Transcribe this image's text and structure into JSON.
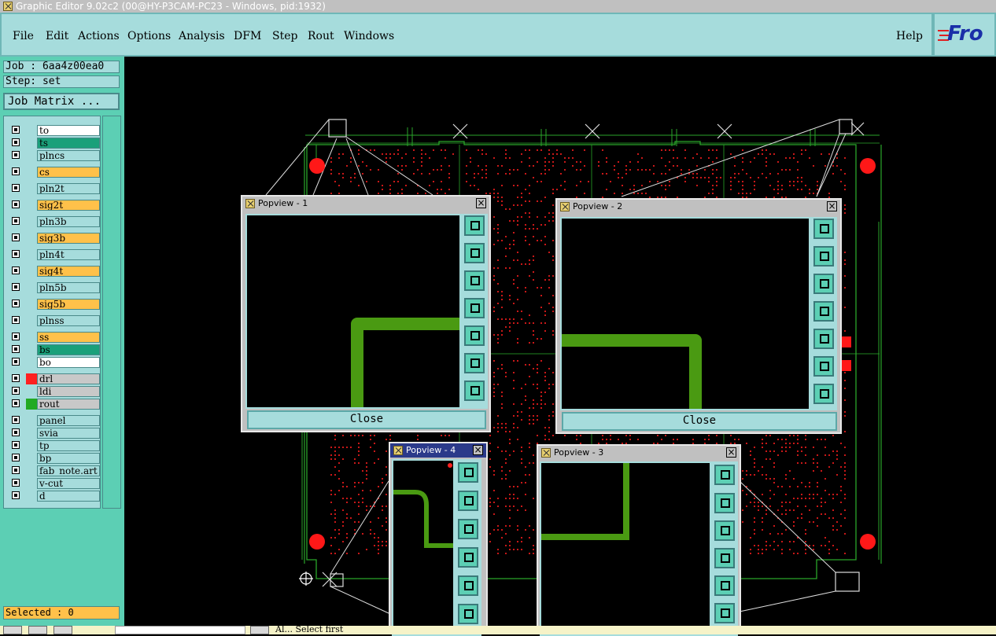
{
  "window": {
    "title": "Graphic Editor 9.02c2 (00@HY-P3CAM-PC23 - Windows, pid:1932)"
  },
  "menu": {
    "items": [
      "File",
      "Edit",
      "Actions",
      "Options",
      "Analysis",
      "DFM",
      "Step",
      "Rout",
      "Windows"
    ],
    "help": "Help",
    "logo": "Fro"
  },
  "job": {
    "label": "Job : 6aa4z00ea0",
    "step": "Step: set",
    "matrix_button": "Job Matrix ..."
  },
  "layers": [
    {
      "name": "to",
      "color": "#ffffff"
    },
    {
      "name": "ts",
      "color": "#1aa07a"
    },
    {
      "name": "plncs",
      "color": "#a6dcdc"
    },
    {
      "name": "cs",
      "color": "#ffc14a"
    },
    {
      "name": "pln2t",
      "color": "#a6dcdc"
    },
    {
      "name": "sig2t",
      "color": "#ffc14a"
    },
    {
      "name": "pln3b",
      "color": "#a6dcdc"
    },
    {
      "name": "sig3b",
      "color": "#ffc14a"
    },
    {
      "name": "pln4t",
      "color": "#a6dcdc"
    },
    {
      "name": "sig4t",
      "color": "#ffc14a"
    },
    {
      "name": "pln5b",
      "color": "#a6dcdc"
    },
    {
      "name": "sig5b",
      "color": "#ffc14a"
    },
    {
      "name": "plnss",
      "color": "#a6dcdc"
    },
    {
      "name": "ss",
      "color": "#ffc14a"
    },
    {
      "name": "bs",
      "color": "#1aa07a"
    },
    {
      "name": "bo",
      "color": "#ffffff"
    },
    {
      "name": "drl",
      "color": "#c8c8c8",
      "swatch": "#ff2020"
    },
    {
      "name": "ldi",
      "color": "#c8c8c8"
    },
    {
      "name": "rout",
      "color": "#c8c8c8",
      "swatch": "#22aa22"
    },
    {
      "name": "panel",
      "color": "#a6dcdc"
    },
    {
      "name": "svia",
      "color": "#a6dcdc"
    },
    {
      "name": "tp",
      "color": "#a6dcdc"
    },
    {
      "name": "bp",
      "color": "#a6dcdc"
    },
    {
      "name": "fab_note.art",
      "color": "#a6dcdc"
    },
    {
      "name": "v-cut",
      "color": "#a6dcdc"
    },
    {
      "name": "d",
      "color": "#a6dcdc"
    }
  ],
  "status": {
    "selected": "Selected : 0",
    "message": "Al... Select first"
  },
  "popviews": [
    {
      "title": "Popview - 1",
      "close": "Close"
    },
    {
      "title": "Popview - 2",
      "close": "Close"
    },
    {
      "title": "Popview - 4"
    },
    {
      "title": "Popview - 3"
    }
  ],
  "colors": {
    "accent": "#a6dcdc",
    "panel": "#5ccfb4",
    "highlight": "#ffc14a",
    "trace": "#4a9a12",
    "pad": "#ff2020"
  }
}
